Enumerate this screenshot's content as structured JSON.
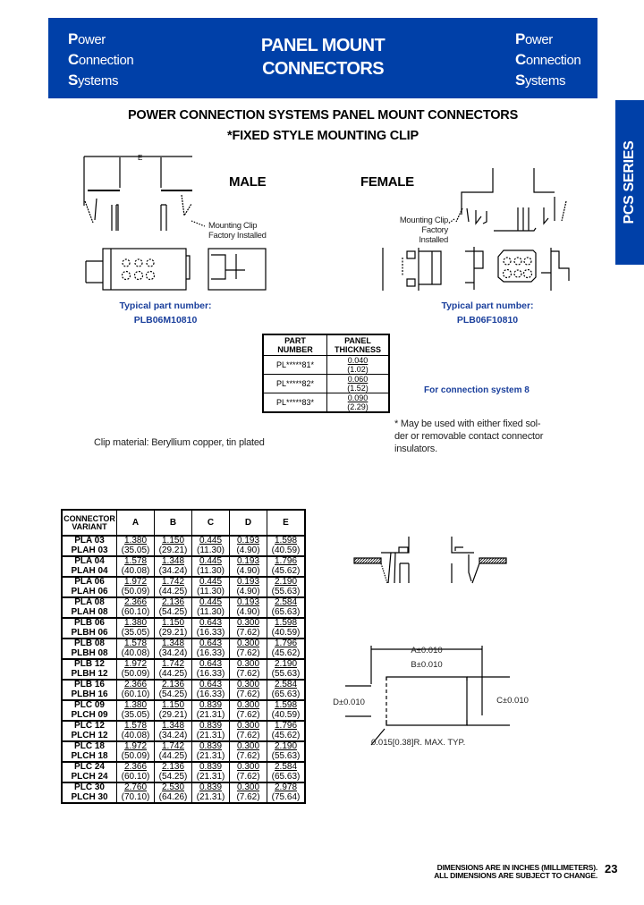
{
  "header": {
    "brand_lines": [
      {
        "cap": "P",
        "rest": "ower"
      },
      {
        "cap": "C",
        "rest": "onnection"
      },
      {
        "cap": "S",
        "rest": "ystems"
      }
    ],
    "title_line1": "PANEL MOUNT",
    "title_line2": "CONNECTORS",
    "colors": {
      "header_bg": "#0040a8",
      "accent_text": "#1a3f9c"
    }
  },
  "side_tab": {
    "label": "PCS SERIES"
  },
  "page_title": {
    "line1": "POWER CONNECTION SYSTEMS PANEL MOUNT CONNECTORS",
    "line2": "*FIXED STYLE MOUNTING CLIP"
  },
  "male": {
    "label": "MALE",
    "dimension_label": "E",
    "clip_note_line1": "Mounting Clip",
    "clip_note_line2": "Factory Installed",
    "typical_label": "Typical part number:",
    "typical_part": "PLB06M10810"
  },
  "female": {
    "label": "FEMALE",
    "clip_note_line1": "Mounting Clip",
    "clip_note_line2": "Factory Installed",
    "typical_label": "Typical part number:",
    "typical_part": "PLB06F10810"
  },
  "panel_table": {
    "headers": [
      "PART NUMBER",
      "PANEL THICKNESS"
    ],
    "rows": [
      {
        "part": "PL*****81*",
        "inch": "0.040",
        "mm": "(1.02)"
      },
      {
        "part": "PL*****82*",
        "inch": "0.060",
        "mm": "(1.52)"
      },
      {
        "part": "PL*****83*",
        "inch": "0.090",
        "mm": "(2.29)"
      }
    ]
  },
  "connection_note": "For connection system 8",
  "asterisk_note": {
    "line1": "*  May be used with either fixed sol-",
    "line2": "der or removable contact connector",
    "line3": "insulators."
  },
  "clip_material": "Clip material:  Beryllium copper, tin plated",
  "dimension_table": {
    "headers": [
      "CONNECTOR VARIANT",
      "A",
      "B",
      "C",
      "D",
      "E"
    ],
    "rows": [
      {
        "v1": "PLA 03",
        "v2": "PLAH 03",
        "cells": [
          [
            "1.380",
            "(35.05)"
          ],
          [
            "1.150",
            "(29.21)"
          ],
          [
            "0.445",
            "(11.30)"
          ],
          [
            "0.193",
            "(4.90)"
          ],
          [
            "1.598",
            "(40.59)"
          ]
        ]
      },
      {
        "v1": "PLA 04",
        "v2": "PLAH 04",
        "cells": [
          [
            "1.578",
            "(40.08)"
          ],
          [
            "1.348",
            "(34.24)"
          ],
          [
            "0.445",
            "(11.30)"
          ],
          [
            "0.193",
            "(4.90)"
          ],
          [
            "1.796",
            "(45.62)"
          ]
        ]
      },
      {
        "v1": "PLA 06",
        "v2": "PLAH 06",
        "cells": [
          [
            "1.972",
            "(50.09)"
          ],
          [
            "1.742",
            "(44.25)"
          ],
          [
            "0.445",
            "(11.30)"
          ],
          [
            "0.193",
            "(4.90)"
          ],
          [
            "2.190",
            "(55.63)"
          ]
        ]
      },
      {
        "v1": "PLA 08",
        "v2": "PLAH 08",
        "cells": [
          [
            "2.366",
            "(60.10)"
          ],
          [
            "2.136",
            "(54.25)"
          ],
          [
            "0.445",
            "(11.30)"
          ],
          [
            "0.193",
            "(4.90)"
          ],
          [
            "2.584",
            "(65.63)"
          ]
        ]
      },
      {
        "v1": "PLB 06",
        "v2": "PLBH 06",
        "cells": [
          [
            "1.380",
            "(35.05)"
          ],
          [
            "1.150",
            "(29.21)"
          ],
          [
            "0.643",
            "(16.33)"
          ],
          [
            "0.300",
            "(7.62)"
          ],
          [
            "1.598",
            "(40.59)"
          ]
        ]
      },
      {
        "v1": "PLB 08",
        "v2": "PLBH 08",
        "cells": [
          [
            "1.578",
            "(40.08)"
          ],
          [
            "1.348",
            "(34.24)"
          ],
          [
            "0.643",
            "(16.33)"
          ],
          [
            "0.300",
            "(7.62)"
          ],
          [
            "1.796",
            "(45.62)"
          ]
        ]
      },
      {
        "v1": "PLB 12",
        "v2": "PLBH 12",
        "cells": [
          [
            "1.972",
            "(50.09)"
          ],
          [
            "1.742",
            "(44.25)"
          ],
          [
            "0.643",
            "(16.33)"
          ],
          [
            "0.300",
            "(7.62)"
          ],
          [
            "2.190",
            "(55.63)"
          ]
        ]
      },
      {
        "v1": "PLB 16",
        "v2": "PLBH 16",
        "cells": [
          [
            "2.366",
            "(60.10)"
          ],
          [
            "2.136",
            "(54.25)"
          ],
          [
            "0.643",
            "(16.33)"
          ],
          [
            "0.300",
            "(7.62)"
          ],
          [
            "2.584",
            "(65.63)"
          ]
        ]
      },
      {
        "v1": "PLC 09",
        "v2": "PLCH 09",
        "cells": [
          [
            "1.380",
            "(35.05)"
          ],
          [
            "1.150",
            "(29.21)"
          ],
          [
            "0.839",
            "(21.31)"
          ],
          [
            "0.300",
            "(7.62)"
          ],
          [
            "1.598",
            "(40.59)"
          ]
        ]
      },
      {
        "v1": "PLC 12",
        "v2": "PLCH 12",
        "cells": [
          [
            "1.578",
            "(40.08)"
          ],
          [
            "1.348",
            "(34.24)"
          ],
          [
            "0.839",
            "(21.31)"
          ],
          [
            "0.300",
            "(7.62)"
          ],
          [
            "1.796",
            "(45.62)"
          ]
        ]
      },
      {
        "v1": "PLC 18",
        "v2": "PLCH 18",
        "cells": [
          [
            "1.972",
            "(50.09)"
          ],
          [
            "1.742",
            "(44.25)"
          ],
          [
            "0.839",
            "(21.31)"
          ],
          [
            "0.300",
            "(7.62)"
          ],
          [
            "2.190",
            "(55.63)"
          ]
        ]
      },
      {
        "v1": "PLC 24",
        "v2": "PLCH 24",
        "cells": [
          [
            "2.366",
            "(60.10)"
          ],
          [
            "2.136",
            "(54.25)"
          ],
          [
            "0.839",
            "(21.31)"
          ],
          [
            "0.300",
            "(7.62)"
          ],
          [
            "2.584",
            "(65.63)"
          ]
        ]
      },
      {
        "v1": "PLC 30",
        "v2": "PLCH 30",
        "cells": [
          [
            "2.760",
            "(70.10)"
          ],
          [
            "2.530",
            "(64.26)"
          ],
          [
            "0.839",
            "(21.31)"
          ],
          [
            "0.300",
            "(7.62)"
          ],
          [
            "2.978",
            "(75.64)"
          ]
        ]
      }
    ]
  },
  "cutout": {
    "a_label": "A±0.010",
    "b_label": "B±0.010",
    "c_label": "C±0.010",
    "d_label": "D±0.010",
    "radius_note": "0.015[0.38]R. MAX. TYP."
  },
  "footer": {
    "line1": "DIMENSIONS ARE IN INCHES (MILLIMETERS).",
    "line2": "ALL DIMENSIONS ARE SUBJECT TO CHANGE.",
    "page_number": "23"
  }
}
